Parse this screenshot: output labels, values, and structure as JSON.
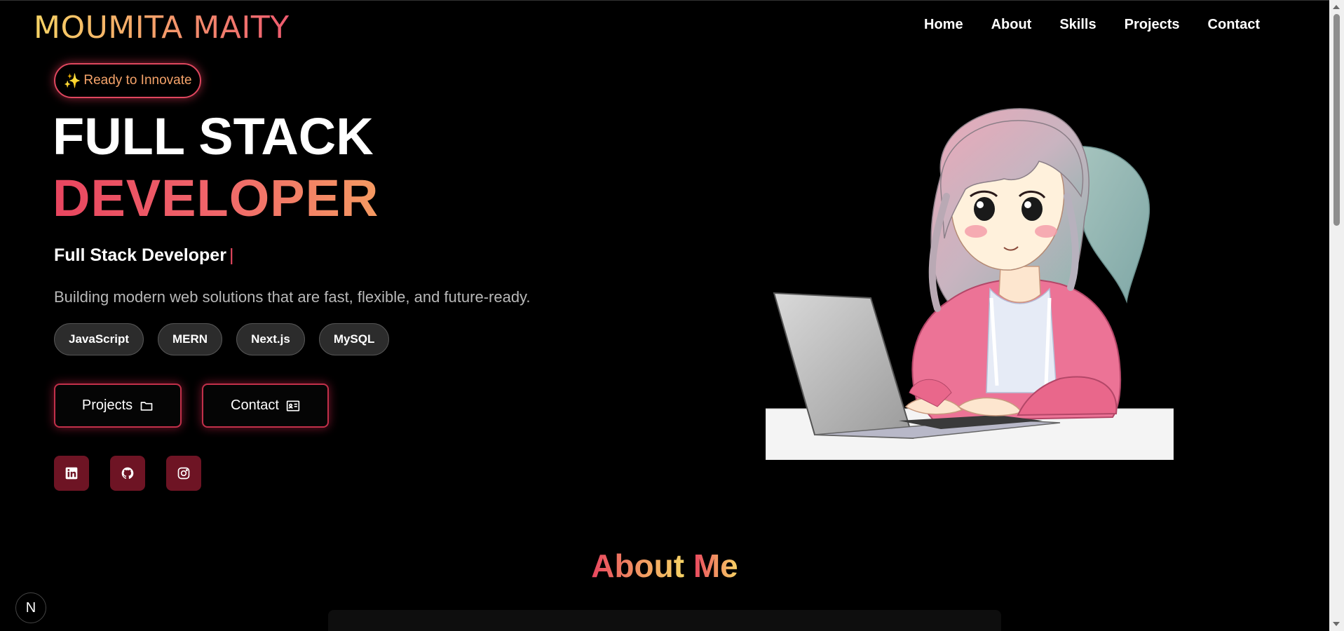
{
  "header": {
    "logo": "MOUMITA MAITY",
    "nav": [
      "Home",
      "About",
      "Skills",
      "Projects",
      "Contact"
    ]
  },
  "hero": {
    "badge_icon": "sparkles",
    "badge": "Ready to Innovate",
    "title_line1": "FULL STACK",
    "title_line2": "DEVELOPER",
    "typed_text": "Full Stack Developer",
    "caret": "|",
    "tagline": "Building modern web solutions that are fast, flexible, and future-ready.",
    "skills": [
      "JavaScript",
      "MERN",
      "Next.js",
      "MySQL"
    ],
    "buttons": {
      "projects": "Projects",
      "contact": "Contact"
    },
    "social": [
      "linkedin-icon",
      "github-icon",
      "instagram-icon"
    ]
  },
  "about": {
    "title_part1": "About",
    "title_part2": "Me"
  },
  "dev_badge": "N",
  "colors": {
    "accent_pink": "#e8455f",
    "accent_orange": "#f59a62",
    "accent_yellow": "#f6d365",
    "social_bg": "#6e1424",
    "background": "#000000"
  }
}
